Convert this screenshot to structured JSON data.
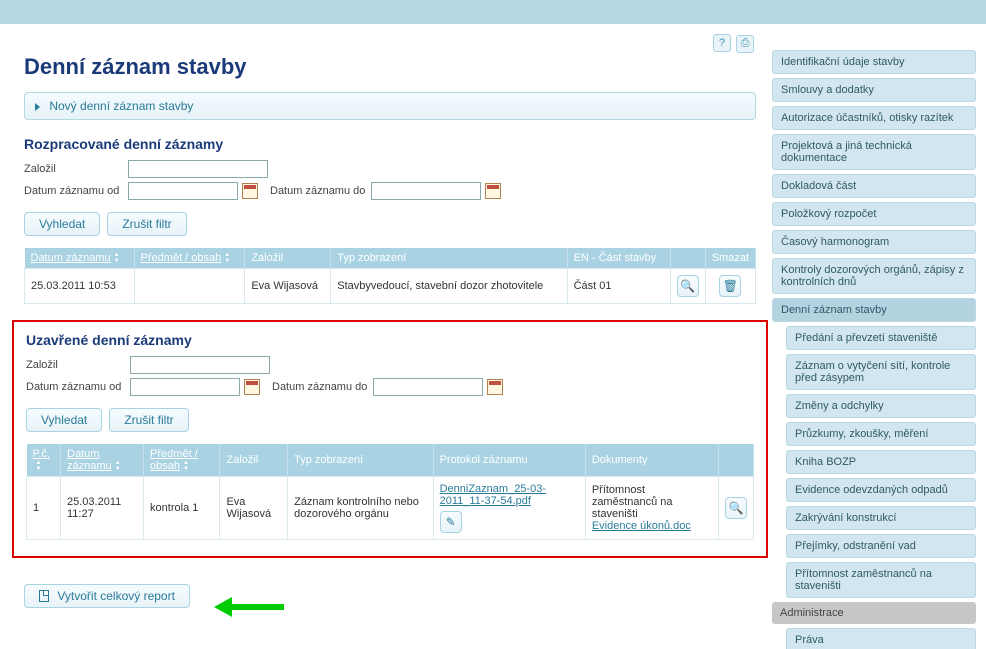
{
  "page": {
    "title": "Denní záznam stavby"
  },
  "disclosure": {
    "label": "Nový denní záznam stavby"
  },
  "sections": {
    "drafts": {
      "title": "Rozpracované denní záznamy"
    },
    "closed": {
      "title": "Uzavřené denní záznamy"
    }
  },
  "filters": {
    "founded_by_label": "Založil",
    "date_from_label": "Datum záznamu od",
    "date_to_label": "Datum záznamu do",
    "search_btn": "Vyhledat",
    "reset_btn": "Zrušit filtr"
  },
  "draft_table": {
    "cols": {
      "date": "Datum záznamu",
      "subject": "Předmět / obsah",
      "created_by": "Založil",
      "display_type": "Typ zobrazení",
      "part": "EN - Část stavby",
      "delete": "Smazat"
    },
    "row": {
      "date": "25.03.2011 10:53",
      "subject": "",
      "created_by": "Eva Wijasová",
      "display_type": "Stavbyvedoucí, stavební dozor zhotovitele",
      "part": "Část 01"
    }
  },
  "closed_table": {
    "cols": {
      "no": "P.č.",
      "date": "Datum záznamu",
      "subject": "Předmět / obsah",
      "created_by": "Založil",
      "display_type": "Typ zobrazení",
      "protocol": "Protokol záznamu",
      "documents": "Dokumenty"
    },
    "row": {
      "no": "1",
      "date": "25.03.2011 11:27",
      "subject": "kontrola 1",
      "created_by": "Eva Wijasová",
      "display_type": "Záznam kontrolního nebo dozorového orgánu",
      "protocol_link": "DenniZaznam_25-03-2011_11-37-54.pdf",
      "doc_text_1": "Přítomnost zaměstnanců na staveništi",
      "doc_link": "Evidence úkonů.doc"
    }
  },
  "report_btn": "Vytvořit celkový report",
  "sidebar": {
    "items": [
      "Identifikační údaje stavby",
      "Smlouvy a dodatky",
      "Autorizace účastníků, otisky razítek",
      "Projektová a jiná technická dokumentace",
      "Dokladová část",
      "Položkový rozpočet",
      "Časový harmonogram",
      "Kontroly dozorových orgánů, zápisy z kontrolních dnů",
      "Denní záznam stavby"
    ],
    "sub": [
      "Předání a převzetí staveniště",
      "Záznam o vytyčení sítí, kontrole před zásypem",
      "Změny a odchylky",
      "Průzkumy, zkoušky, měření",
      "Kniha BOZP",
      "Evidence odevzdaných odpadů",
      "Zakrývání konstrukcí",
      "Přejímky, odstranění vad",
      "Přítomnost zaměstnanců na staveništi"
    ],
    "admin_header": "Administrace",
    "admin_items": [
      "Práva"
    ]
  }
}
